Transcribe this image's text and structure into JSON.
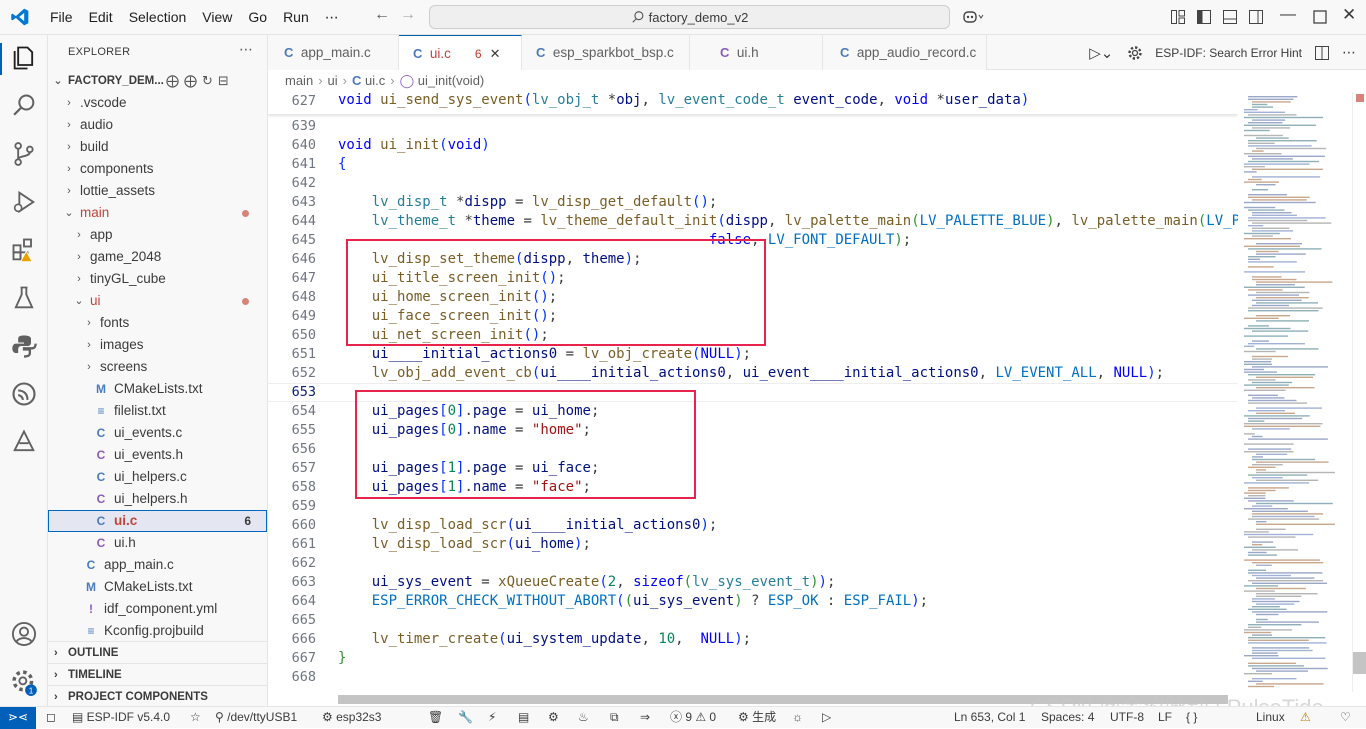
{
  "titlebar": {
    "menus": [
      "File",
      "Edit",
      "Selection",
      "View",
      "Go",
      "Run",
      "⋯"
    ],
    "search_text": "factory_demo_v2"
  },
  "explorer": {
    "title": "EXPLORER",
    "more": "⋯",
    "root": "FACTORY_DEM...",
    "items": [
      {
        "label": ".vscode",
        "kind": "folder",
        "open": false,
        "depth": 1
      },
      {
        "label": "audio",
        "kind": "folder",
        "open": false,
        "depth": 1
      },
      {
        "label": "build",
        "kind": "folder",
        "open": false,
        "depth": 1
      },
      {
        "label": "components",
        "kind": "folder",
        "open": false,
        "depth": 1
      },
      {
        "label": "lottie_assets",
        "kind": "folder",
        "open": false,
        "depth": 1
      },
      {
        "label": "main",
        "kind": "folder",
        "open": true,
        "depth": 1,
        "color": "#c0453b",
        "dot": true
      },
      {
        "label": "app",
        "kind": "folder",
        "open": false,
        "depth": 2
      },
      {
        "label": "game_2048",
        "kind": "folder",
        "open": false,
        "depth": 2
      },
      {
        "label": "tinyGL_cube",
        "kind": "folder",
        "open": false,
        "depth": 2
      },
      {
        "label": "ui",
        "kind": "folder",
        "open": true,
        "depth": 2,
        "color": "#c0453b",
        "dot": true
      },
      {
        "label": "fonts",
        "kind": "folder",
        "open": false,
        "depth": 3
      },
      {
        "label": "images",
        "kind": "folder",
        "open": false,
        "depth": 3
      },
      {
        "label": "screens",
        "kind": "folder",
        "open": false,
        "depth": 3
      },
      {
        "label": "CMakeLists.txt",
        "kind": "file",
        "icon": "M",
        "icon_color": "#4b7bbf",
        "depth": 3
      },
      {
        "label": "filelist.txt",
        "kind": "file",
        "icon": "≡",
        "icon_color": "#4b7bbf",
        "depth": 3
      },
      {
        "label": "ui_events.c",
        "kind": "file",
        "icon": "C",
        "icon_color": "#4b7bbf",
        "depth": 3
      },
      {
        "label": "ui_events.h",
        "kind": "file",
        "icon": "C",
        "icon_color": "#8a5cbf",
        "depth": 3
      },
      {
        "label": "ui_helpers.c",
        "kind": "file",
        "icon": "C",
        "icon_color": "#4b7bbf",
        "depth": 3
      },
      {
        "label": "ui_helpers.h",
        "kind": "file",
        "icon": "C",
        "icon_color": "#8a5cbf",
        "depth": 3
      },
      {
        "label": "ui.c",
        "kind": "file",
        "icon": "C",
        "icon_color": "#4b7bbf",
        "depth": 3,
        "selected": true,
        "badge": "6",
        "color": "#c0453b"
      },
      {
        "label": "ui.h",
        "kind": "file",
        "icon": "C",
        "icon_color": "#8a5cbf",
        "depth": 3
      },
      {
        "label": "app_main.c",
        "kind": "file",
        "icon": "C",
        "icon_color": "#4b7bbf",
        "depth": 2
      },
      {
        "label": "CMakeLists.txt",
        "kind": "file",
        "icon": "M",
        "icon_color": "#4b7bbf",
        "depth": 2
      },
      {
        "label": "idf_component.yml",
        "kind": "file",
        "icon": "!",
        "icon_color": "#8a5cbf",
        "depth": 2
      },
      {
        "label": "Kconfig.projbuild",
        "kind": "file",
        "icon": "≡",
        "icon_color": "#4b7bbf",
        "depth": 2
      }
    ],
    "panels": [
      "OUTLINE",
      "TIMELINE",
      "PROJECT COMPONENTS"
    ]
  },
  "tabs": [
    {
      "label": "app_main.c",
      "icon": "C",
      "active": false
    },
    {
      "label": "ui.c",
      "icon": "C",
      "active": true,
      "count": "6",
      "close": "✕"
    },
    {
      "label": "esp_sparkbot_bsp.c",
      "icon": "C",
      "active": false
    },
    {
      "label": "ui.h",
      "icon": "C",
      "active": false,
      "header": true
    },
    {
      "label": "app_audio_record.c",
      "icon": "C",
      "active": false
    }
  ],
  "editor_actions": {
    "hint": "ESP-IDF: Search Error Hint"
  },
  "breadcrumb": [
    "main",
    "ui",
    "ui.c",
    "ui_init(void)"
  ],
  "code": {
    "sticky_line": {
      "no": "627",
      "text": "void ui_send_sys_event(lv_obj_t *obj, lv_event_code_t event_code, void *user_data)"
    },
    "lines": [
      {
        "no": "639",
        "text": ""
      },
      {
        "no": "640",
        "text": "void ui_init(void)"
      },
      {
        "no": "641",
        "text": "{"
      },
      {
        "no": "642",
        "text": ""
      },
      {
        "no": "643",
        "text": "    lv_disp_t *dispp = lv_disp_get_default();"
      },
      {
        "no": "644",
        "text": "    lv_theme_t *theme = lv_theme_default_init(dispp, lv_palette_main(LV_PALETTE_BLUE), lv_palette_main(LV_P"
      },
      {
        "no": "645",
        "text": "                                            false, LV_FONT_DEFAULT);"
      },
      {
        "no": "646",
        "text": "    lv_disp_set_theme(dispp, theme);"
      },
      {
        "no": "647",
        "text": "    ui_title_screen_init();"
      },
      {
        "no": "648",
        "text": "    ui_home_screen_init();"
      },
      {
        "no": "649",
        "text": "    ui_face_screen_init();"
      },
      {
        "no": "650",
        "text": "    ui_net_screen_init();"
      },
      {
        "no": "651",
        "text": "    ui____initial_actions0 = lv_obj_create(NULL);"
      },
      {
        "no": "652",
        "text": "    lv_obj_add_event_cb(ui____initial_actions0, ui_event____initial_actions0, LV_EVENT_ALL, NULL);"
      },
      {
        "no": "653",
        "text": ""
      },
      {
        "no": "654",
        "text": "    ui_pages[0].page = ui_home;"
      },
      {
        "no": "655",
        "text": "    ui_pages[0].name = \"home\";"
      },
      {
        "no": "656",
        "text": ""
      },
      {
        "no": "657",
        "text": "    ui_pages[1].page = ui_face;"
      },
      {
        "no": "658",
        "text": "    ui_pages[1].name = \"face\";"
      },
      {
        "no": "659",
        "text": ""
      },
      {
        "no": "660",
        "text": "    lv_disp_load_scr(ui____initial_actions0);"
      },
      {
        "no": "661",
        "text": "    lv_disp_load_scr(ui_home);"
      },
      {
        "no": "662",
        "text": ""
      },
      {
        "no": "663",
        "text": "    ui_sys_event = xQueueCreate(2, sizeof(lv_sys_event_t));"
      },
      {
        "no": "664",
        "text": "    ESP_ERROR_CHECK_WITHOUT_ABORT((ui_sys_event) ? ESP_OK : ESP_FAIL);"
      },
      {
        "no": "665",
        "text": ""
      },
      {
        "no": "666",
        "text": "    lv_timer_create(ui_system_update, 10,  NULL);"
      },
      {
        "no": "667",
        "text": "}"
      },
      {
        "no": "668",
        "text": ""
      }
    ],
    "current_line": "653"
  },
  "statusbar": {
    "idf": "ESP-IDF v5.4.0",
    "port": "/dev/ttyUSB1",
    "target": "esp32s3",
    "problems": "ⓧ 9 ⚠ 0",
    "build": "生成",
    "position": "Ln 653, Col 1",
    "spaces": "Spaces: 4",
    "encoding": "UTF-8",
    "eol": "LF",
    "language_icon": "{ }",
    "os": "Linux"
  },
  "watermark": "CSDN @金汐脉动 | PulseTide",
  "colors": {
    "accent": "#005fb8",
    "highlight_box": "#e8244c",
    "keyword": "#0000ff",
    "type": "#267f99",
    "function": "#795e26",
    "string": "#a31515"
  }
}
